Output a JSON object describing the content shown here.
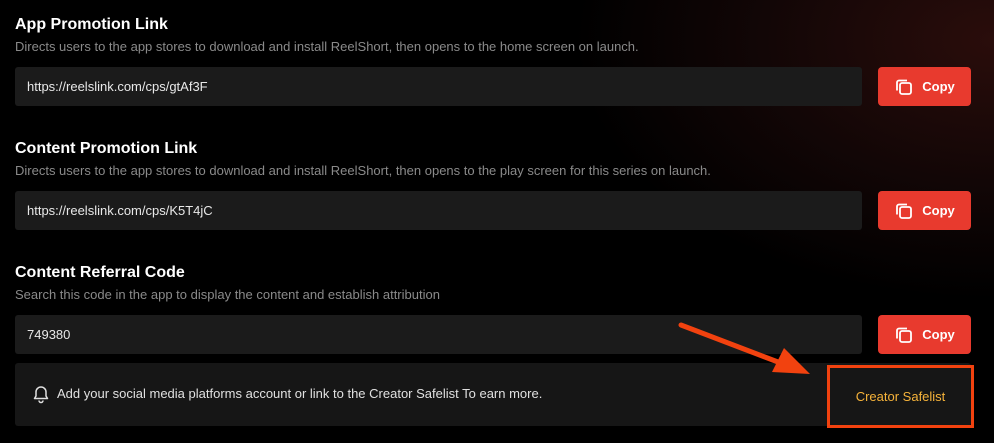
{
  "sections": [
    {
      "title": "App Promotion Link",
      "description": "Directs users to the app stores to download and install ReelShort, then opens to the home screen on launch.",
      "value": "https://reelslink.com/cps/gtAf3F",
      "copy_label": "Copy"
    },
    {
      "title": "Content Promotion Link",
      "description": "Directs users to the app stores to download and install ReelShort, then opens to the play screen for this series on launch.",
      "value": "https://reelslink.com/cps/K5T4jC",
      "copy_label": "Copy"
    },
    {
      "title": "Content Referral Code",
      "description": "Search this code in the app to display the content and establish attribution",
      "value": "749380",
      "copy_label": "Copy"
    }
  ],
  "notice": {
    "icon": "bell-icon",
    "text": "Add your social media platforms account or link to the Creator Safelist To earn more.",
    "link_label": "Creator Safelist"
  },
  "colors": {
    "accent": "#e83a2e",
    "link": "#f6b33a",
    "highlight": "#f2420f"
  }
}
